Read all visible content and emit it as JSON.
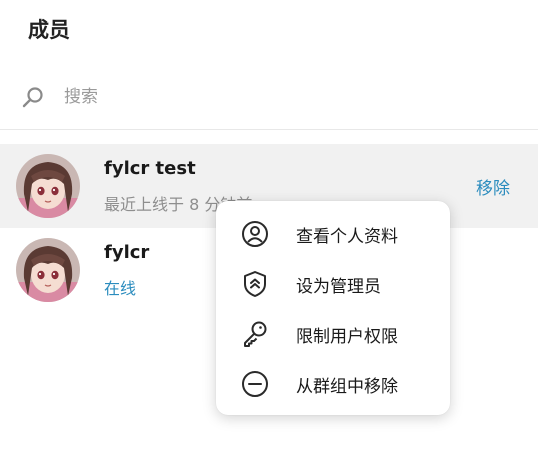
{
  "title": "成员",
  "search": {
    "placeholder": "搜索",
    "value": ""
  },
  "members": [
    {
      "name": "fylcr test",
      "status": "最近上线于 8 分钟前",
      "action": "移除",
      "highlighted": true
    },
    {
      "name": "fylcr",
      "status": "在线",
      "status_type": "online"
    }
  ],
  "context_menu": {
    "items": [
      {
        "label": "查看个人资料",
        "icon": "person-circle-icon"
      },
      {
        "label": "设为管理员",
        "icon": "shield-up-icon"
      },
      {
        "label": "限制用户权限",
        "icon": "key-icon"
      },
      {
        "label": "从群组中移除",
        "icon": "minus-circle-icon"
      }
    ]
  },
  "colors": {
    "accent": "#2b8cbe",
    "muted": "#8e8e8e",
    "highlight": "#f1f1f1"
  }
}
